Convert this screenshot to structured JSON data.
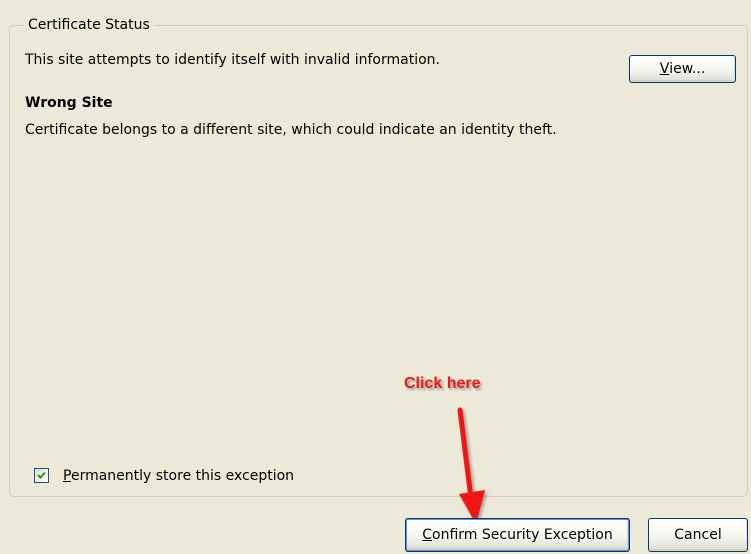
{
  "group": {
    "legend": "Certificate Status"
  },
  "status": {
    "message": "This site attempts to identify itself with invalid information.",
    "view_button": {
      "accel": "V",
      "rest": "iew..."
    }
  },
  "problem": {
    "title": "Wrong Site",
    "description": "Certificate belongs to a different site, which could indicate an identity theft."
  },
  "checkbox": {
    "checked": true,
    "label_accel": "P",
    "label_rest": "ermanently store this exception"
  },
  "annotation": {
    "text": "Click here",
    "color": "#F01818"
  },
  "buttons": {
    "confirm": {
      "accel": "C",
      "rest": "onfirm Security Exception"
    },
    "cancel": "Cancel"
  }
}
